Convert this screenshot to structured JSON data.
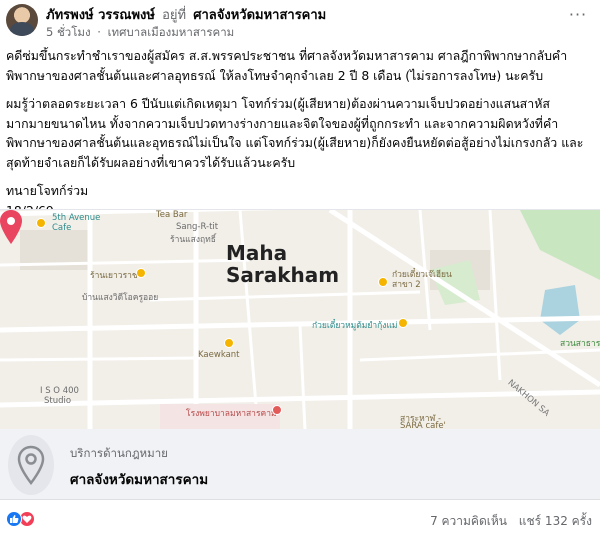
{
  "header": {
    "author": "ภัทรพงษ์ วรรณพงษ์",
    "at_word": "อยู่ที่",
    "place": "ศาลจังหวัดมหาสารคาม",
    "time": "5 ชั่วโมง",
    "separator": "·",
    "location": "เทศบาลเมืองมหาสารคาม",
    "more_label": "···"
  },
  "post": {
    "paragraph1": "คดีซ่มขึ้นกระทำชำเราของผู้สมัคร ส.ส.พรรคประชาชน ที่ศาลจังหวัดมหาสารคาม ศาลฎีกาพิพากษากลับคำพิพากษาของศาลชั้นต้นและศาลอุทธรณ์ ให้ลงโทษจำคุกจำเลย 2 ปี 8 เดือน (ไม่รอการลงโทษ) นะครับ",
    "paragraph2": "ผมรู้ว่าตลอดระยะเวลา 6 ปีนับแต่เกิดเหตุมา โจทก์ร่วม(ผู้เสียหาย)ต้องผ่านความเจ็บปวดอย่างแสนสาหัสมากมายขนาดไหน ทั้งจากความเจ็บปวดทางร่างกายและจิตใจของผู้ที่ถูกกระทำ และจากความผิดหวังที่คำพิพากษาของศาลชั้นต้นและอุทธรณ์ไม่เป็นใจ แต่โจทก์ร่วม(ผู้เสียหาย)ก็ยังคงยืนหยัดต่อสู้อย่างไม่เกรงกลัว และสุดท้ายจำเลยก็ได้รับผลอย่างที่เขาควรได้รับแล้วนะครับ",
    "signature": "ทนายโจทก์ร่วม",
    "date": "18/2/69"
  },
  "map": {
    "city_line1": "Maha",
    "city_line2": "Sarakham",
    "labels": {
      "fifth_avenue": "5th Avenue",
      "cafe": "Cafe",
      "tea_bar": "Tea Bar",
      "sang_r_tit": "Sang-R-tit",
      "sang_r_tit_th": "ร้านแสงฤทธิ์",
      "shop_1": "ร้านเยาวราช",
      "shop_2": "บ้านแสงวิดีโอครูออย",
      "noodle_1": "ก๋วยเตี๋ยวเจ๊เฮียน",
      "noodle_1b": "สาขา 2",
      "noodle_2": "ก๋วยเตี๋ยวหมูต้มยำกุ้งแม่",
      "kaewkant": "Kaewkant",
      "iso_studio": "I S O 400",
      "iso_studio2": "Studio",
      "hospital": "โรงพยาบาลมหาสารคาม",
      "nakhon_sawan": "NAKHON SA",
      "sara_cafe": "สาระหาฬ -",
      "sara_cafe2": "SARA cafe'",
      "park": "สวนสาธารณ"
    }
  },
  "place_card": {
    "category": "บริการด้านกฎหมาย",
    "name": "ศาลจังหวัดมหาสารคาม"
  },
  "footer": {
    "comments": "7 ความคิดเห็น",
    "shares": "แชร์ 132 ครั้ง"
  },
  "colors": {
    "like": "#1877f2",
    "love": "#f33e58",
    "pin": "#e94560",
    "map_bg": "#f2efe9",
    "park_green": "#c8e6c0",
    "water": "#aad3df"
  }
}
